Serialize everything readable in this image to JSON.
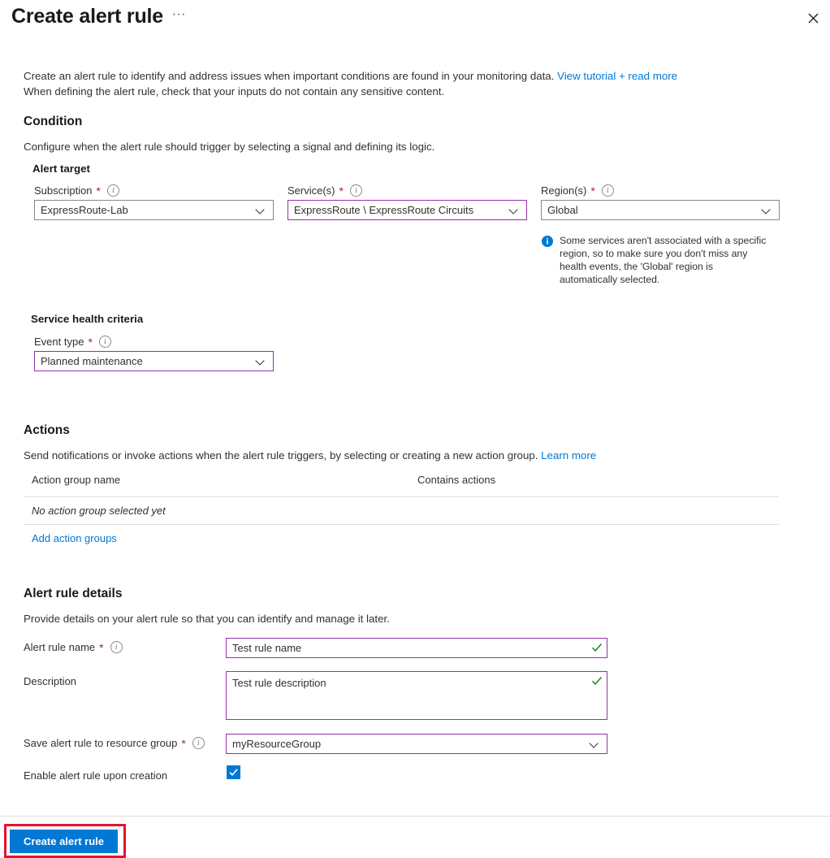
{
  "header": {
    "title": "Create alert rule",
    "more_label": "···",
    "close_label": "✕"
  },
  "intro": {
    "line1_prefix": "Create an alert rule to identify and address issues when important conditions are found in your monitoring data. ",
    "line1_link": "View tutorial + read more",
    "line2": "When defining the alert rule, check that your inputs do not contain any sensitive content."
  },
  "condition": {
    "title": "Condition",
    "description": "Configure when the alert rule should trigger by selecting a signal and defining its logic.",
    "alert_target_title": "Alert target",
    "subscription": {
      "label": "Subscription",
      "required": "*",
      "value": "ExpressRoute-Lab"
    },
    "services": {
      "label": "Service(s)",
      "required": "*",
      "value": "ExpressRoute \\ ExpressRoute Circuits"
    },
    "regions": {
      "label": "Region(s)",
      "required": "*",
      "value": "Global"
    },
    "region_note": "Some services aren't associated with a specific region, so to make sure you don't miss any health events, the 'Global' region is automatically selected.",
    "criteria_title": "Service health criteria",
    "event_type": {
      "label": "Event type",
      "required": "*",
      "value": "Planned maintenance"
    }
  },
  "actions": {
    "title": "Actions",
    "description_prefix": "Send notifications or invoke actions when the alert rule triggers, by selecting or creating a new action group. ",
    "description_link": "Learn more",
    "columns": {
      "name": "Action group name",
      "contains": "Contains actions"
    },
    "empty_row": "No action group selected yet",
    "add_link": "Add action groups"
  },
  "alert_rule_details": {
    "title": "Alert rule details",
    "description": "Provide details on your alert rule so that you can identify and manage it later.",
    "rule_name": {
      "label": "Alert rule name",
      "required": "*",
      "value": "Test rule name"
    },
    "rule_description": {
      "label": "Description",
      "value": "Test rule description"
    },
    "resource_group": {
      "label": "Save alert rule to resource group",
      "required": "*",
      "value": "myResourceGroup"
    },
    "enable_rule": {
      "label": "Enable alert rule upon creation",
      "checked": true
    }
  },
  "footer": {
    "create_label": "Create alert rule"
  },
  "colors": {
    "accent": "#0078d4",
    "required": "#a4262c",
    "modified_border": "#9333a8",
    "valid_check": "#107c10",
    "annotation": "#e8112d",
    "link": "#0078d4"
  }
}
